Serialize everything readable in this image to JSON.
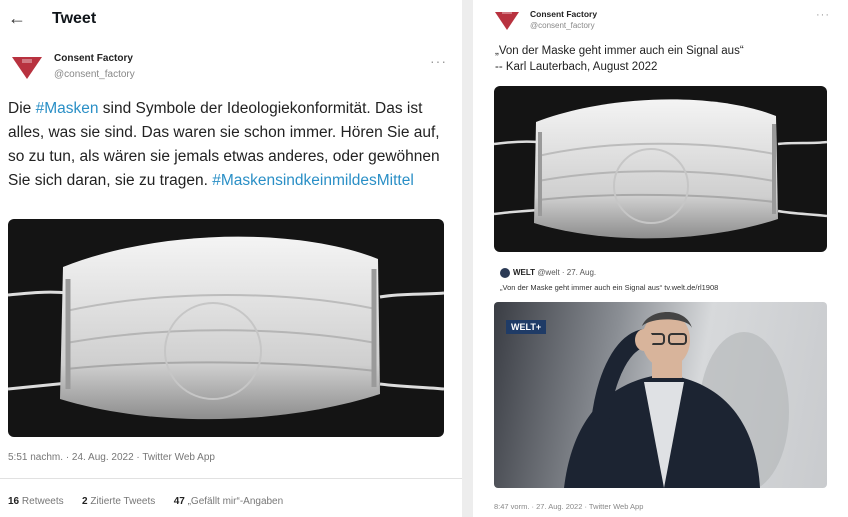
{
  "left_tweet": {
    "header_title": "Tweet",
    "author_name": "Consent Factory",
    "author_handle": "@consent_factory",
    "more": "···",
    "text_parts": [
      "Die ",
      "#Masken",
      " sind Symbole der Ideologiekonformität. Das ist alles, was sie sind. Das waren sie schon immer. Hören Sie auf, so zu tun, als wären sie jemals etwas anderes, oder gewöhnen Sie sich daran, sie zu tragen. ",
      "#MaskensindkeinmildesMittel"
    ],
    "timestamp": "5:51 nachm. · 24. Aug. 2022 · Twitter Web App",
    "stats": {
      "retweets_count": "16",
      "retweets_label": "Retweets",
      "quotes_count": "2",
      "quotes_label": "Zitierte Tweets",
      "likes_count": "47",
      "likes_label": "„Gefällt mir“-Angaben"
    }
  },
  "right_tweet": {
    "author_name": "Consent Factory",
    "author_handle": "@consent_factory",
    "more": "···",
    "quote_line1": "„Von der Maske geht immer auch ein Signal aus“",
    "quote_line2": "-- Karl Lauterbach, August 2022",
    "embedded": {
      "source_name": "WELT",
      "source_meta": "@welt · 27. Aug.",
      "text": "„Von der Maske geht immer auch ein Signal aus“ tv.welt.de/rl1908",
      "logo_text": "WELT+"
    },
    "timestamp": "8:47 vorm. · 27. Aug. 2022 · Twitter Web App"
  },
  "colors": {
    "logo": "#b8323f",
    "hashtag": "#2a8fc6",
    "welt_blue": "#1f3b66"
  }
}
